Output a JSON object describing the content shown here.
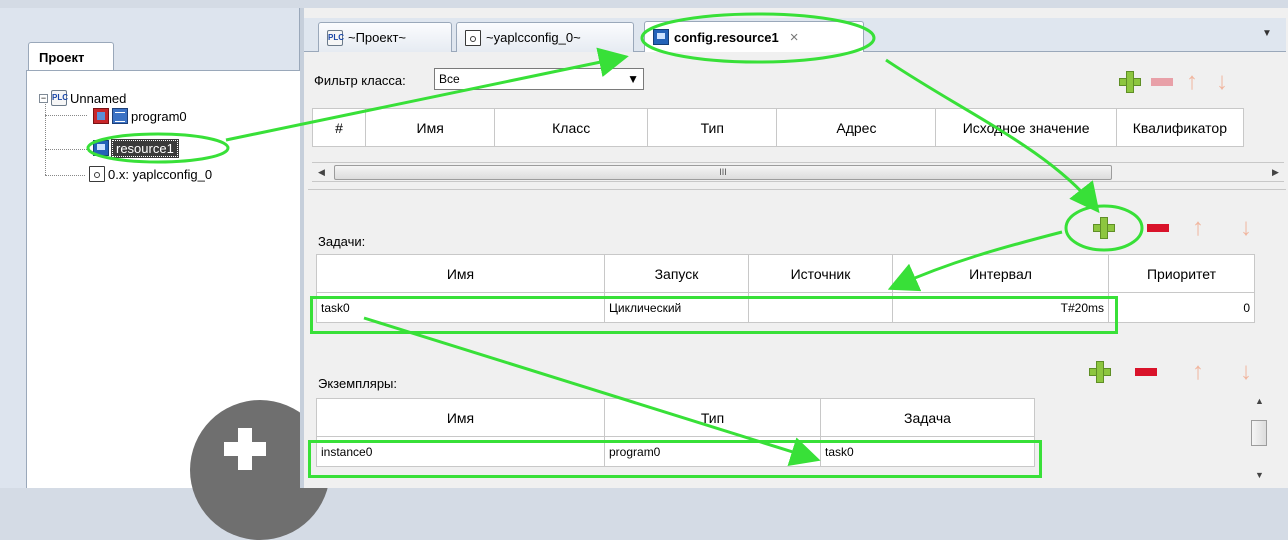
{
  "left_panel": {
    "tab_label": "Проект",
    "tree": [
      {
        "label": "Unnamed",
        "icon": "plc-icon"
      },
      {
        "label": "program0",
        "icon": "program-icon"
      },
      {
        "label": "resource1",
        "icon": "resource-icon"
      },
      {
        "label": "0.x: yaplcconfig_0",
        "icon": "config-icon"
      }
    ]
  },
  "tabs": [
    {
      "label": "~Проект~",
      "icon": "plc-icon"
    },
    {
      "label": "~yaplcconfig_0~",
      "icon": "config-icon"
    },
    {
      "label": "config.resource1",
      "icon": "resource-icon",
      "active": true,
      "close": "×"
    }
  ],
  "tab_menu": "▼",
  "variables": {
    "filter_label": "Фильтр класса:",
    "filter_value": "Все",
    "columns": [
      "#",
      "Имя",
      "Класс",
      "Тип",
      "Адрес",
      "Исходное значение",
      "Квалификатор"
    ],
    "scroll_thumb": "III"
  },
  "tasks": {
    "label": "Задачи:",
    "columns": [
      "Имя",
      "Запуск",
      "Источник",
      "Интервал",
      "Приоритет"
    ],
    "rows": [
      {
        "name": "task0",
        "trigger": "Циклический",
        "source": "",
        "interval": "T#20ms",
        "priority": "0"
      }
    ]
  },
  "instances": {
    "label": "Экземпляры:",
    "columns": [
      "Имя",
      "Тип",
      "Задача"
    ],
    "rows": [
      {
        "name": "instance0",
        "type": "program0",
        "task": "task0"
      }
    ]
  },
  "icons": {
    "add": "plus-icon",
    "remove": "minus-icon",
    "up": "arrow-up-icon",
    "down": "arrow-down-icon",
    "up_glyph": "↑",
    "down_glyph": "↓"
  },
  "colors": {
    "annotation": "#38e038",
    "add_green": "#8dc63f",
    "remove_red": "#d9132a",
    "arrow_orange": "#f1b69f",
    "selection": "#3a3a3a"
  }
}
